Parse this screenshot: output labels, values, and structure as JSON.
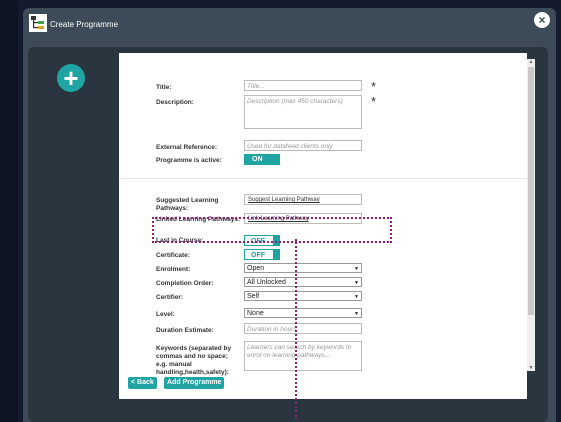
{
  "window": {
    "title": "Create Programme"
  },
  "icons": {
    "app": "pathway-tree-icon",
    "close": "close-icon",
    "add": "plus-icon"
  },
  "form": {
    "title": {
      "label": "Title:",
      "placeholder": "Title...",
      "required_mark": "*"
    },
    "description": {
      "label": "Description:",
      "placeholder": "Description (max 450 characters)",
      "required_mark": "*"
    },
    "external_reference": {
      "label": "External Reference:",
      "placeholder": "Used for datafeed clients only"
    },
    "programme_active": {
      "label": "Programme is active:",
      "value": "ON"
    },
    "suggested_pathways": {
      "label": "Suggested Learning Pathways:",
      "link": "Suggest Learning Pathway"
    },
    "linked_pathways": {
      "label": "Linked Learning Pathways:",
      "link": "Link Learning Pathway"
    },
    "last_in_course": {
      "label": "Last in Course:",
      "value": "OFF"
    },
    "certificate": {
      "label": "Certificate:",
      "value": "OFF"
    },
    "enrolment": {
      "label": "Enrolment:",
      "value": "Open"
    },
    "completion_order": {
      "label": "Completion Order:",
      "value": "All Unlocked"
    },
    "certifier": {
      "label": "Certifier:",
      "value": "Self"
    },
    "level": {
      "label": "Level:",
      "value": "None"
    },
    "duration": {
      "label": "Duration Estimate:",
      "placeholder": "Duration in hours"
    },
    "keywords": {
      "label": "Keywords (separated by commas and no space; e.g. manual handling,health,safety):",
      "placeholder": "Learners can search by keywords to enrol on learning pathways..."
    }
  },
  "footer": {
    "back": "< Back",
    "add": "Add Programme"
  },
  "colors": {
    "accent": "#1fa3a3",
    "highlight": "#8a1e7a",
    "frame": "#3d4a57"
  }
}
